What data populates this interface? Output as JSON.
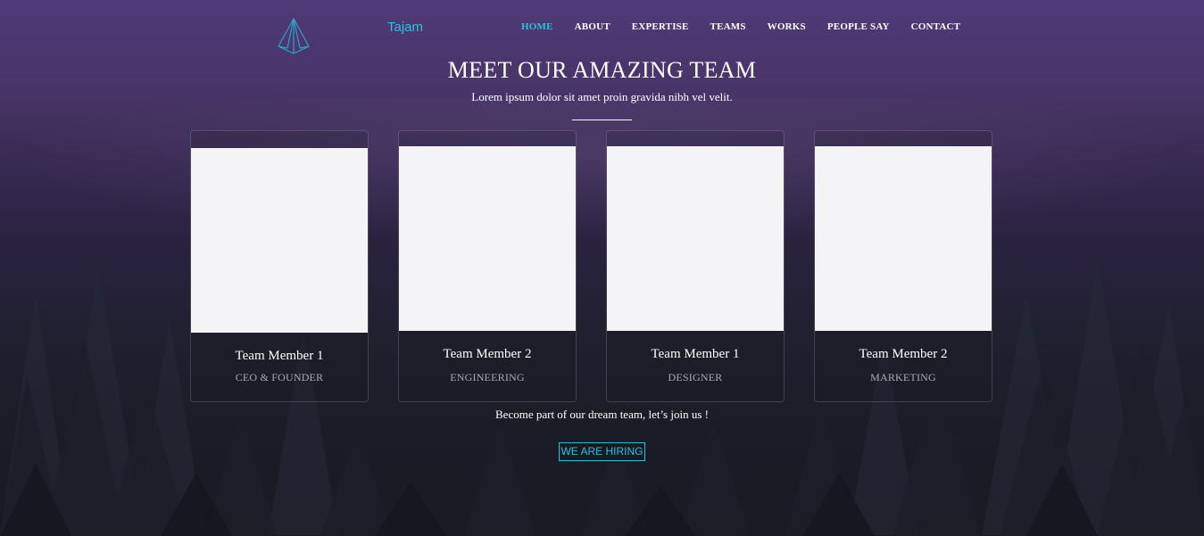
{
  "brand": {
    "name": "Tajam",
    "logo_icon": "paper-plane-logo-icon",
    "accent": "#29c3dc"
  },
  "nav": {
    "items": [
      {
        "label": "HOME",
        "active": true
      },
      {
        "label": "ABOUT",
        "active": false
      },
      {
        "label": "EXPERTISE",
        "active": false
      },
      {
        "label": "TEAMS",
        "active": false
      },
      {
        "label": "WORKS",
        "active": false
      },
      {
        "label": "PEOPLE SAY",
        "active": false
      },
      {
        "label": "CONTACT",
        "active": false
      }
    ]
  },
  "section": {
    "title": "MEET OUR AMAZING TEAM",
    "subtitle": "Lorem ipsum dolor sit amet proin gravida nibh vel velit."
  },
  "team": [
    {
      "name": "Team Member 1",
      "role": "CEO & FOUNDER"
    },
    {
      "name": "Team Member 2",
      "role": "ENGINEERING"
    },
    {
      "name": "Team Member 1",
      "role": "DESIGNER"
    },
    {
      "name": "Team Member 2",
      "role": "MARKETING"
    }
  ],
  "join": {
    "text": "Become part of our dream team, let’s join us !",
    "button": "WE ARE HIRING"
  }
}
